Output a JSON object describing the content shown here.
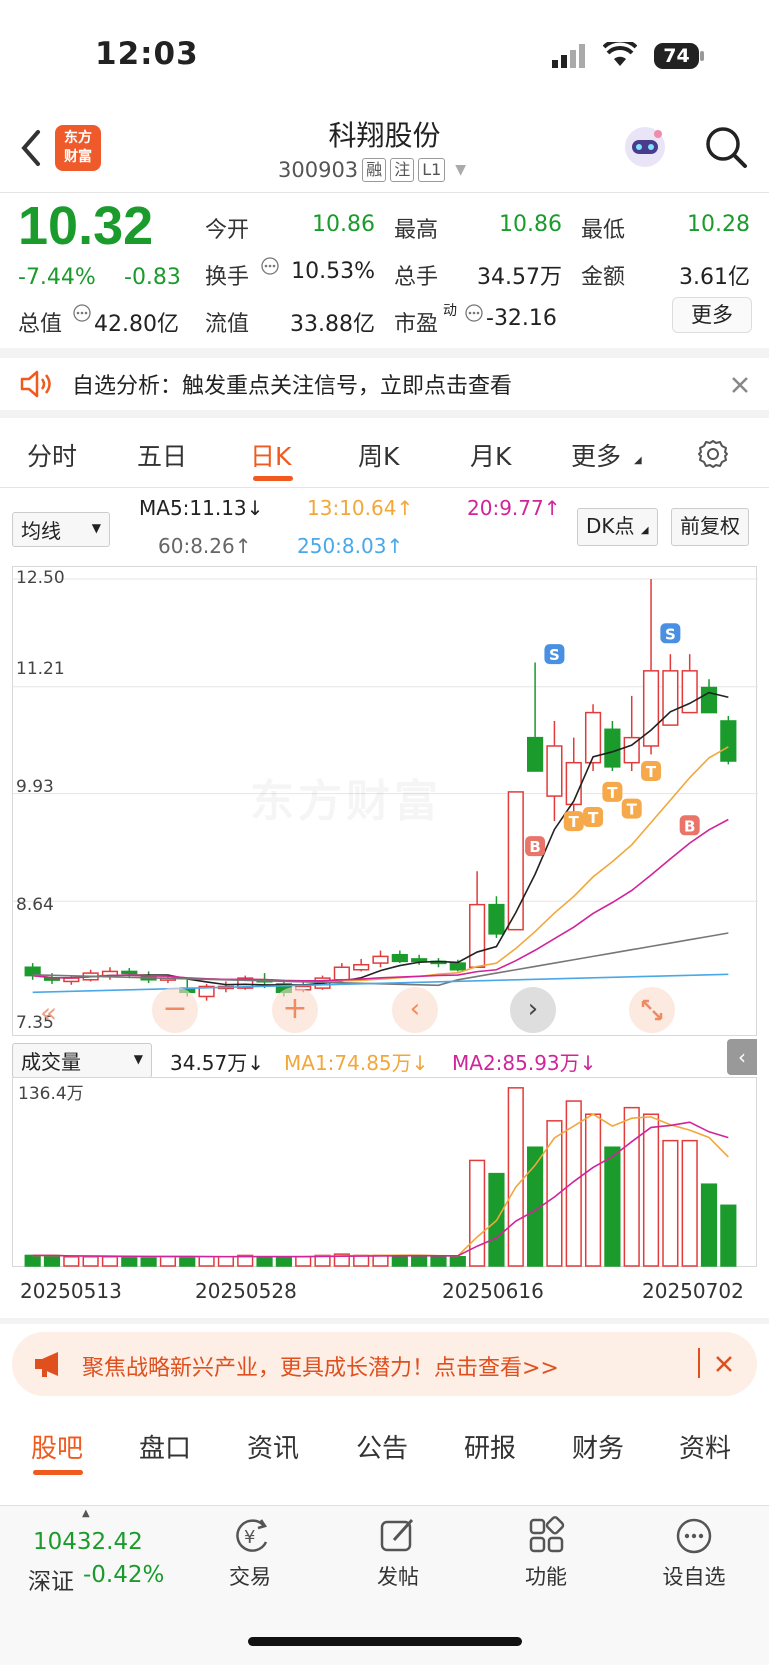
{
  "status": {
    "time": "12:03",
    "battery": "74"
  },
  "header": {
    "logo": "东方\n财富",
    "title": "科翔股份",
    "code": "300903",
    "tags": [
      "融",
      "注",
      "L1"
    ]
  },
  "quote": {
    "price": "10.32",
    "change_pct": "-7.44%",
    "change": "-0.83",
    "open_label": "今开",
    "open": "10.86",
    "high_label": "最高",
    "high": "10.86",
    "low_label": "最低",
    "low": "10.28",
    "turnover_label": "换手",
    "turnover": "10.53%",
    "volume_label": "总手",
    "volume": "34.57万",
    "amount_label": "金额",
    "amount": "3.61亿",
    "mcap_label": "总值",
    "mcap": "42.80亿",
    "float_label": "流值",
    "float": "33.88亿",
    "pe_label": "市盈",
    "pe_sup": "动",
    "pe": "-32.16",
    "more_label": "更多"
  },
  "notice": {
    "text": "自选分析：触发重点关注信号，立即点击查看"
  },
  "period_tabs": [
    "分时",
    "五日",
    "日K",
    "周K",
    "月K",
    "更多"
  ],
  "indicators": {
    "ma_select": "均线",
    "ma5": "MA5:11.13↓",
    "ma13": "13:10.64↑",
    "ma20": "20:9.77↑",
    "ma60": "60:8.26↑",
    "ma250": "250:8.03↑",
    "dk_button": "DK点",
    "fq_button": "前复权"
  },
  "chart_data": {
    "type": "candlestick",
    "yticks": [
      "12.50",
      "11.21",
      "9.93",
      "8.64",
      "7.35"
    ],
    "ylim": [
      7.35,
      12.5
    ],
    "markers": [
      "S",
      "S",
      "B",
      "B",
      "T",
      "T",
      "T",
      "T",
      "T"
    ],
    "volume": {
      "select": "成交量",
      "current": "34.57万↓",
      "ma1": "MA1:74.85万↓",
      "ma2": "MA2:85.93万↓",
      "max_label": "136.4万"
    },
    "dates": [
      "20250513",
      "20250528",
      "20250616",
      "20250702"
    ]
  },
  "watermark": "东方财富",
  "banner": {
    "text": "聚焦战略新兴产业，更具成长潜力！点击查看>>"
  },
  "bottom_tabs": [
    "股吧",
    "盘口",
    "资讯",
    "公告",
    "研报",
    "财务",
    "资料"
  ],
  "bottom_bar": {
    "index_value": "10432.42",
    "index_name": "深证",
    "index_change": "-0.42%",
    "items": [
      "交易",
      "发帖",
      "功能",
      "设自选"
    ]
  }
}
